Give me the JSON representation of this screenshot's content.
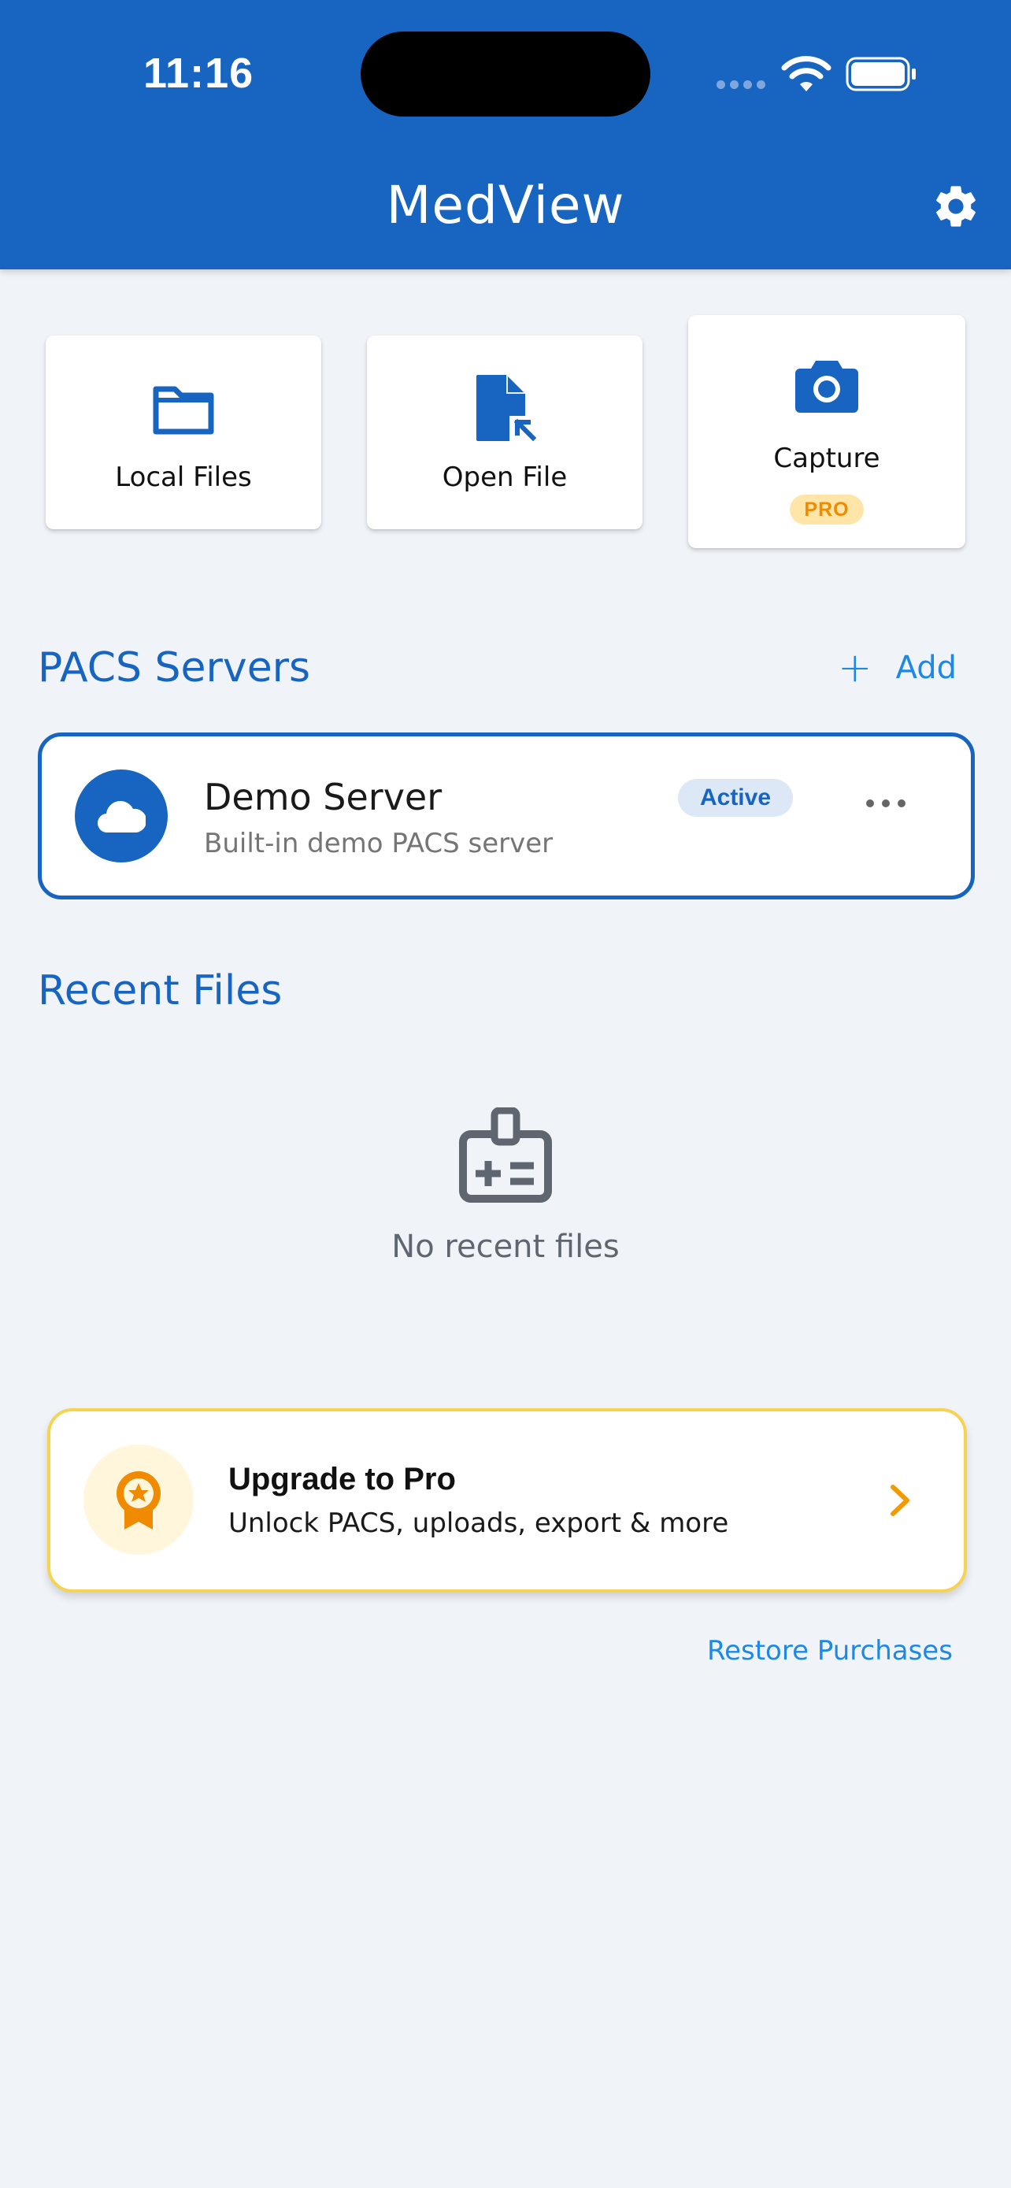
{
  "status_bar": {
    "time": "11:16"
  },
  "app": {
    "title": "MedView"
  },
  "quick_actions": [
    {
      "label": "Local Files",
      "icon": "folder-icon"
    },
    {
      "label": "Open File",
      "icon": "open-file-icon"
    },
    {
      "label": "Capture",
      "icon": "camera-icon",
      "badge": "PRO"
    }
  ],
  "pacs": {
    "title": "PACS Servers",
    "add_label": "Add",
    "servers": [
      {
        "name": "Demo Server",
        "description": "Built-in demo PACS server",
        "status": "Active",
        "icon": "cloud-icon"
      }
    ]
  },
  "recent": {
    "title": "Recent Files",
    "empty_text": "No recent files",
    "empty_icon": "id-card-clip-icon"
  },
  "upgrade": {
    "title": "Upgrade to Pro",
    "subtitle": "Unlock PACS, uploads, export & more",
    "icon": "award-badge-icon"
  },
  "restore_label": "Restore Purchases",
  "colors": {
    "primary": "#1765c0",
    "accent_link": "#1e88e5",
    "pro_badge_bg": "#ffe6a8",
    "pro_badge_text": "#f08a00",
    "upgrade_border": "#f7d354",
    "background": "#f0f3f8"
  }
}
